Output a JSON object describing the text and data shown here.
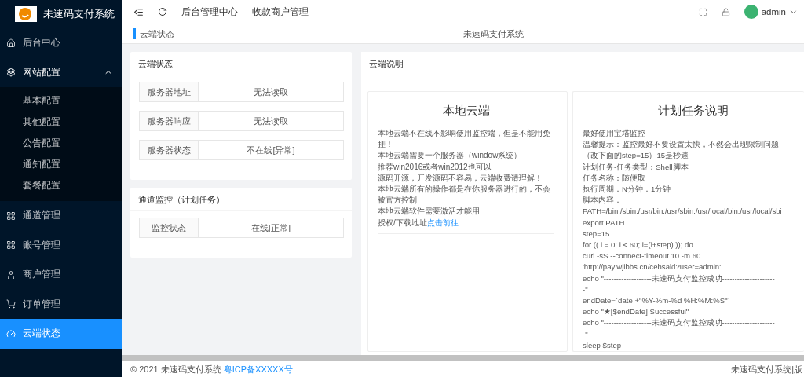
{
  "sidebar": {
    "logo_text": "未速码支付系统",
    "items": [
      {
        "label": "后台中心",
        "selected": false
      },
      {
        "label": "网站配置",
        "selected": false,
        "expanded": true,
        "children": [
          {
            "label": "基本配置",
            "selected": false
          },
          {
            "label": "其他配置",
            "selected": false
          },
          {
            "label": "公告配置",
            "selected": false
          },
          {
            "label": "通知配置",
            "selected": false
          },
          {
            "label": "套餐配置",
            "selected": false
          }
        ]
      },
      {
        "label": "通道管理",
        "selected": false
      },
      {
        "label": "账号管理",
        "selected": false
      },
      {
        "label": "商户管理",
        "selected": false
      },
      {
        "label": "订单管理",
        "selected": false
      },
      {
        "label": "云端状态",
        "selected": true
      }
    ]
  },
  "header": {
    "nav": [
      "后台管理中心",
      "收款商户管理"
    ],
    "user": "admin"
  },
  "tabs": [
    {
      "label": "云端状态",
      "selected": true
    }
  ],
  "page_title": "未速码支付系统",
  "status_card": {
    "title": "云端状态",
    "rows": [
      {
        "label": "服务器地址",
        "value": "无法读取"
      },
      {
        "label": "服务器响应",
        "value": "无法读取"
      },
      {
        "label": "服务器状态",
        "value": "不在线[异常]"
      }
    ]
  },
  "monitor_card": {
    "title": "通道监控（计划任务）",
    "rows": [
      {
        "label": "监控状态",
        "value": "在线[正常]"
      }
    ]
  },
  "info_panel": {
    "title": "云端说明",
    "local": {
      "title": "本地云端",
      "lines": [
        "本地云端不在线不影响使用监控端，但是不能用免挂！",
        "本地云端需要一个服务器（window系统）",
        "推荐win2016或者win2012也可以",
        "源码开源，开发源码不容易，云端收费请理解！",
        "本地云端所有的操作都是在你服务器进行的，不会被官方控制",
        "本地云端软件需要激活才能用"
      ],
      "link_prefix": "授权/下载地址",
      "link": "点击前往"
    },
    "task": {
      "title": "计划任务说明",
      "lines": [
        "最好使用宝塔监控",
        "温馨提示：监控最好不要设置太快，不然会出现限制问题",
        "（改下面的step=15）15是秒速",
        "计划任务-任务类型：Shell脚本",
        "任务名称：随便取",
        "执行周期：N分钟：1分钟",
        "脚本内容：",
        "PATH=/bin:/sbin:/usr/bin:/usr/sbin:/usr/local/bin:/usr/local/sbi",
        "export PATH",
        "step=15",
        "for (( i = 0; i < 60; i=(i+step) )); do",
        "curl -sS --connect-timeout 10 -m 60",
        "'http://pay.wjibbs.cn/cehsald?user=admin'",
        "echo \"-------------------未速码支付监控成功---------------------",
        "-\"",
        "endDate=`date +\"%Y-%m-%d %H:%M:%S\"`",
        "echo \"★[$endDate] Successful\"",
        "echo \"-------------------未速码支付监控成功---------------------",
        "-\"",
        "sleep $step"
      ]
    }
  },
  "footer": {
    "copyright": "© 2021 未速码支付系统",
    "link": "粤ICP备XXXXX号",
    "right": "未速码支付系统|版"
  }
}
